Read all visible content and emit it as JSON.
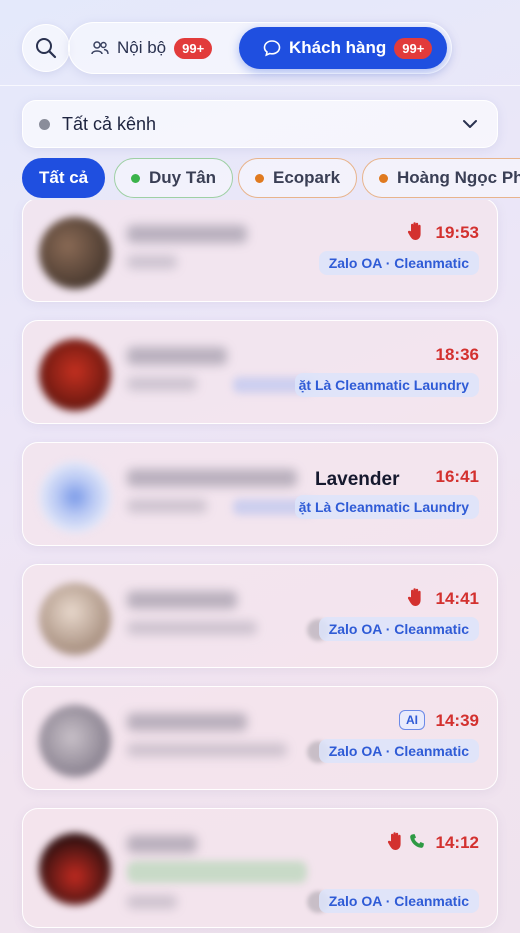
{
  "header": {
    "search_icon": "search-icon",
    "tabs": [
      {
        "label": "Nội bộ",
        "icon": "people-icon",
        "badge": "99+"
      },
      {
        "label": "Khách hàng",
        "icon": "chat-bubble-icon",
        "badge": "99+",
        "active": true
      }
    ]
  },
  "channel_filter": {
    "selected": "Tất cả kênh",
    "dot_color": "#8a8d9a"
  },
  "filter_chips": [
    {
      "label": "Tất cả",
      "active": true
    },
    {
      "label": "Duy Tân",
      "dot_color": "#3bb34a"
    },
    {
      "label": "Ecopark",
      "dot_color": "#e07a1f"
    },
    {
      "label": "Hoàng Ngọc Pha",
      "dot_color": "#e07a1f"
    }
  ],
  "conversations": [
    {
      "time": "19:53",
      "tag": "Zalo OA · Cleanmatic",
      "icons": [
        "hand-icon"
      ]
    },
    {
      "time": "18:36",
      "tag": "ặt Là Cleanmatic Laundry"
    },
    {
      "time": "16:41",
      "tag": "ặt Là Cleanmatic Laundry",
      "name_visible": "Lavender"
    },
    {
      "time": "14:41",
      "tag": "Zalo OA · Cleanmatic",
      "icons": [
        "hand-icon"
      ]
    },
    {
      "time": "14:39",
      "tag": "Zalo OA · Cleanmatic",
      "ai_label": "AI"
    },
    {
      "time": "14:12",
      "tag": "Zalo OA · Cleanmatic",
      "icons": [
        "hand-icon",
        "phone-icon"
      ]
    }
  ],
  "colors": {
    "accent": "#1f4fe0",
    "badge": "#e23b3b",
    "time": "#d3312f",
    "tag_text": "#2f5bd6"
  }
}
